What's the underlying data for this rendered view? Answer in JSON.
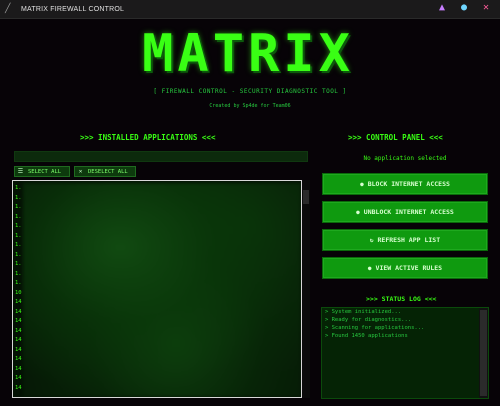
{
  "window": {
    "title": "MATRIX FIREWALL CONTROL",
    "app_icon": "matrix-app-icon",
    "controls": {
      "minimize_icon": "triangle-icon",
      "maximize_icon": "circle-icon",
      "close_icon": "x-icon"
    }
  },
  "header": {
    "logo_text": "MATRIX",
    "subtitle": "[ FIREWALL CONTROL - SECURITY DIAGNOSTIC TOOL ]",
    "credit": "Created by Sp4de for Team06"
  },
  "apps_panel": {
    "title": ">>> INSTALLED APPLICATIONS <<<",
    "search": {
      "value": "",
      "placeholder": ""
    },
    "select_all_label": "SELECT ALL",
    "deselect_all_label": "DESELECT ALL",
    "list_rows": [
      "1.",
      "1.",
      "1.",
      "1.",
      "1.",
      "1.",
      "1.",
      "1.",
      "1.",
      "1.",
      "1.",
      "10",
      "14",
      "14",
      "14",
      "14",
      "14",
      "14",
      "14",
      "14",
      "14",
      "14"
    ]
  },
  "control_panel": {
    "title": ">>> CONTROL PANEL <<<",
    "selection_status": "No application selected",
    "buttons": {
      "block": "BLOCK INTERNET ACCESS",
      "unblock": "UNBLOCK INTERNET ACCESS",
      "refresh": "REFRESH APP LIST",
      "rules": "VIEW ACTIVE RULES"
    }
  },
  "status_log": {
    "title": ">>> STATUS LOG <<<",
    "lines": [
      "> System initialized...",
      "> Ready for diagnostics...",
      "> Scanning for applications...",
      "> Found 1450 applications"
    ]
  },
  "colors": {
    "accent": "#39ff14",
    "button_bg": "#0f9a0f",
    "background": "#070307",
    "minimize": "#c77dff",
    "maximize": "#6fd6ff",
    "close": "#ff5c9a"
  }
}
